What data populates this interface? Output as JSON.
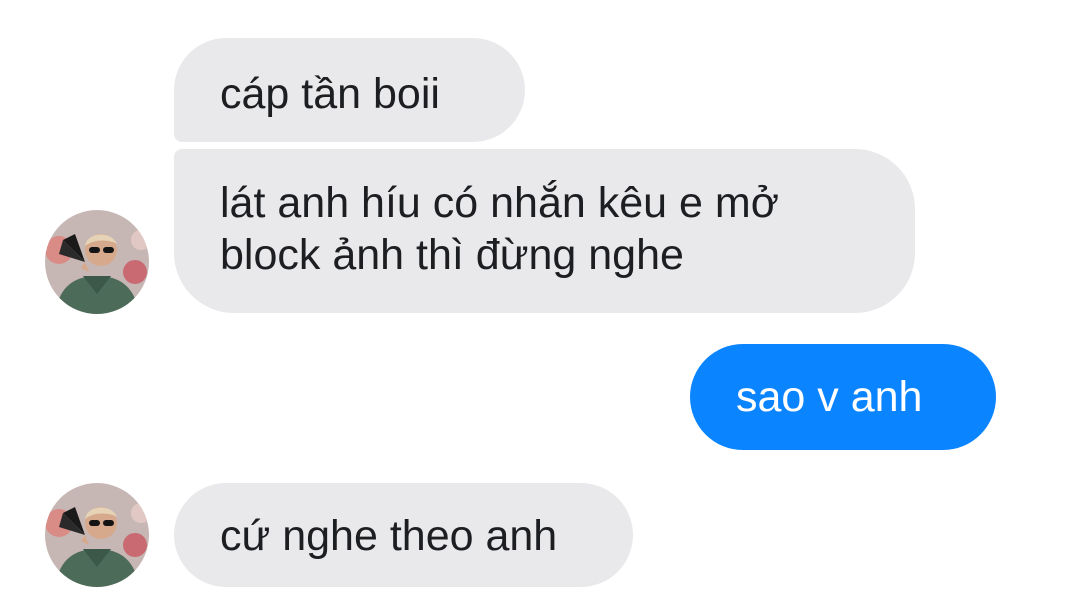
{
  "messages": [
    {
      "direction": "incoming",
      "lines": [
        "cáp tần boii"
      ]
    },
    {
      "direction": "incoming",
      "lines": [
        "lát anh híu có nhắn kêu e mở",
        "block ảnh thì đừng nghe"
      ]
    },
    {
      "direction": "outgoing",
      "lines": [
        "sao v anh"
      ]
    },
    {
      "direction": "incoming",
      "lines": [
        "cứ nghe theo anh"
      ]
    }
  ],
  "avatar": {
    "icon": "user-avatar-photo"
  },
  "colors": {
    "incoming_bubble": "#e9e9eb",
    "outgoing_bubble": "#0a84ff",
    "incoming_text": "#1c1e21",
    "outgoing_text": "#ffffff",
    "background": "#ffffff"
  }
}
